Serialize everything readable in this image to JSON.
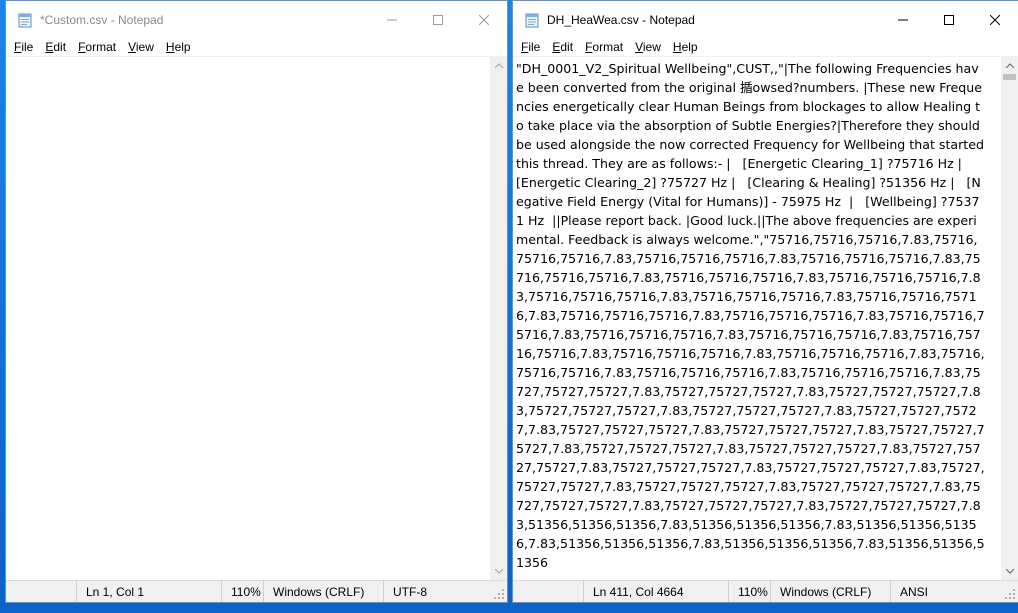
{
  "colors": {
    "desktop": "#0b62c9",
    "window_border": "#6f8fb5",
    "statusbar": "#f0f0f0",
    "scroll_thumb": "#c2c2c2"
  },
  "left_window": {
    "title": "*Custom.csv - Notepad",
    "menu": [
      {
        "label_ul": "F",
        "label_rest": "ile"
      },
      {
        "label_ul": "E",
        "label_rest": "dit"
      },
      {
        "label_ul": "F",
        "label_rest": "ormat"
      },
      {
        "label_ul": "V",
        "label_rest": "iew"
      },
      {
        "label_ul": "H",
        "label_rest": "elp"
      }
    ],
    "content": "",
    "status": {
      "position": "Ln 1, Col 1",
      "zoom": "110%",
      "line_endings": "Windows (CRLF)",
      "encoding": "UTF-8"
    }
  },
  "right_window": {
    "title": "DH_HeaWea.csv - Notepad",
    "menu": [
      {
        "label_ul": "F",
        "label_rest": "ile"
      },
      {
        "label_ul": "E",
        "label_rest": "dit"
      },
      {
        "label_ul": "F",
        "label_rest": "ormat"
      },
      {
        "label_ul": "V",
        "label_rest": "iew"
      },
      {
        "label_ul": "H",
        "label_rest": "elp"
      }
    ],
    "content": "\"DH_0001_V2_Spiritual Wellbeing\",CUST,,\"|The following Frequencies have been converted from the original 揗owsed?numbers. |These new Frequencies energetically clear Human Beings from blockages to allow Healing to take place via the absorption of Subtle Energies?|Therefore they should be used alongside the now corrected Frequency for Wellbeing that started this thread. They are as follows:- |   [Energetic Clearing_1] ?75716 Hz |   [Energetic Clearing_2] ?75727 Hz |   [Clearing & Healing] ?51356 Hz |   [Negative Field Energy (Vital for Humans)] - 75975 Hz  |   [Wellbeing] ?75371 Hz  ||Please report back. |Good luck.||The above frequencies are experimental. Feedback is always welcome.\",\"75716,75716,75716,7.83,75716,75716,75716,7.83,75716,75716,75716,7.83,75716,75716,75716,7.83,75716,75716,75716,7.83,75716,75716,75716,7.83,75716,75716,75716,7.83,75716,75716,75716,7.83,75716,75716,75716,7.83,75716,75716,75716,7.83,75716,75716,75716,7.83,75716,75716,75716,7.83,75716,75716,75716,7.83,75716,75716,75716,7.83,75716,75716,75716,7.83,75716,75716,75716,7.83,75716,75716,75716,7.83,75716,75716,75716,7.83,75716,75716,75716,7.83,75716,75716,75716,7.83,75716,75716,75716,7.83,75727,75727,75727,7.83,75727,75727,75727,7.83,75727,75727,75727,7.83,75727,75727,75727,7.83,75727,75727,75727,7.83,75727,75727,75727,7.83,75727,75727,75727,7.83,75727,75727,75727,7.83,75727,75727,75727,7.83,75727,75727,75727,7.83,75727,75727,75727,7.83,75727,75727,75727,7.83,75727,75727,75727,7.83,75727,75727,75727,7.83,75727,75727,75727,7.83,75727,75727,75727,7.83,75727,75727,75727,7.83,75727,75727,75727,7.83,75727,75727,75727,7.83,75727,75727,75727,7.83,51356,51356,51356,7.83,51356,51356,51356,7.83,51356,51356,51356,7.83,51356,51356,51356,7.83,51356,51356,51356,7.83,51356,51356,51356",
    "status": {
      "position": "Ln 411, Col 4664",
      "zoom": "110%",
      "line_endings": "Windows (CRLF)",
      "encoding": "ANSI"
    }
  }
}
